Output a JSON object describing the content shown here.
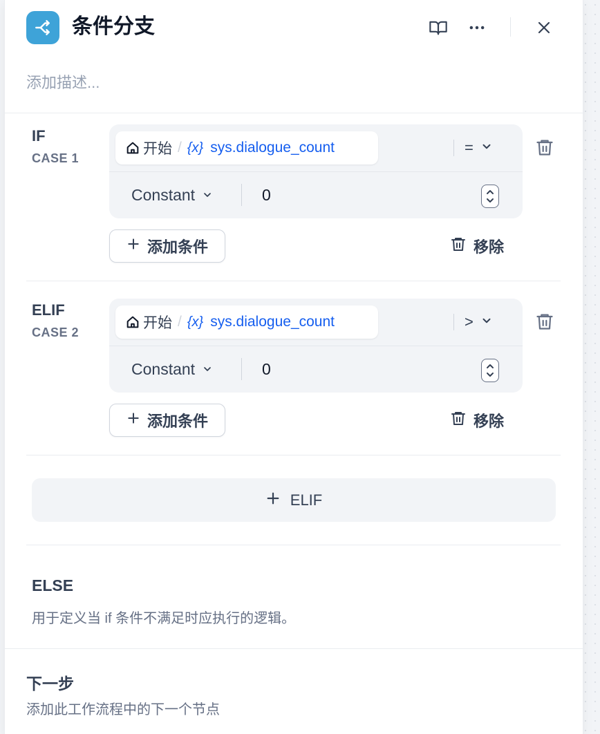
{
  "node": {
    "title": "条件分支",
    "description_placeholder": "添加描述..."
  },
  "cases": [
    {
      "title": "IF",
      "subtitle": "CASE 1",
      "condition": {
        "source_node": "开始",
        "var_icon": "{x}",
        "variable": "sys.dialogue_count",
        "operator": "=",
        "value_type": "Constant",
        "value": "0"
      },
      "add_condition_label": "添加条件",
      "remove_label": "移除"
    },
    {
      "title": "ELIF",
      "subtitle": "CASE 2",
      "condition": {
        "source_node": "开始",
        "var_icon": "{x}",
        "variable": "sys.dialogue_count",
        "operator": ">",
        "value_type": "Constant",
        "value": "0"
      },
      "add_condition_label": "添加条件",
      "remove_label": "移除"
    }
  ],
  "add_elif_label": "ELIF",
  "else": {
    "title": "ELSE",
    "description": "用于定义当 if 条件不满足时应执行的逻辑。"
  },
  "next_step": {
    "title": "下一步",
    "description": "添加此工作流程中的下一个节点"
  },
  "icons": {
    "node": "branch-icon",
    "help": "book-open-icon",
    "more": "more-horizontal-icon",
    "close": "close-icon",
    "delete": "trash-icon",
    "add": "plus-icon",
    "home": "home-icon",
    "dropdown": "chevron-down-icon",
    "stepper": "stepper-icon"
  },
  "colors": {
    "node_icon_bg": "#3ea3d8",
    "variable": "#155eef",
    "panel_bg": "#ffffff",
    "condition_bg": "#f2f4f7"
  }
}
